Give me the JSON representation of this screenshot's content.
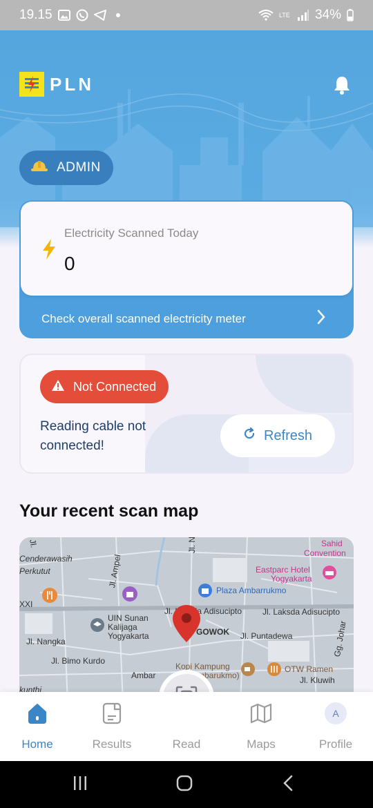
{
  "status_bar": {
    "time": "19.15",
    "battery": "34%",
    "network": "LTE",
    "icons": [
      "gallery-icon",
      "whatsapp-icon",
      "telegram-icon",
      "wifi-icon",
      "signal-icon",
      "battery-icon"
    ]
  },
  "header": {
    "logo_text": "PLN",
    "role_label": "ADMIN"
  },
  "scan_card": {
    "label": "Electricity Scanned Today",
    "count": "0",
    "footer_link": "Check overall scanned electricity meter"
  },
  "connection_card": {
    "status_badge": "Not Connected",
    "message": "Reading cable not connected!",
    "refresh_label": "Refresh",
    "status_color": "#e44d3a"
  },
  "recent_map": {
    "title": "Your recent scan map",
    "labels": {
      "sahid": "Sahid",
      "convention": "Convention",
      "cenderawasih": "Cenderawasih",
      "perkutut": "Perkutut",
      "eastparc": "Eastparc Hotel",
      "yogyakarta": "Yogyakarta",
      "plaza": "Plaza Ambarrukmo",
      "ampel": "Jl. Ampel",
      "uin1": "UIN Sunan",
      "uin2": "Kalijaga",
      "uin3": "Yogyakarta",
      "adisucipto1": "Jl. Laksda Adisucipto",
      "adisucipto2": "Jl. Laksda Adisucipto",
      "gowok": "GOWOK",
      "nangka": "Jl. Nangka",
      "puntadewa": "Jl. Puntadewa",
      "johar": "Gg. Johar",
      "bimo": "Jl. Bimo Kurdo",
      "kopi1": "Kopi Kampung",
      "kopi2": "(Ambarukmo)",
      "ambar": "Ambar",
      "otw": "OTW Ramen",
      "kluwih": "Jl. Kluwih",
      "xxi": "XXI",
      "kunthi": "kunthi",
      "jl_top": "Jl.",
      "jl_n": "Jl. N"
    }
  },
  "bottom_nav": {
    "items": [
      {
        "label": "Home",
        "icon": "home-icon",
        "active": true
      },
      {
        "label": "Results",
        "icon": "document-icon",
        "active": false
      },
      {
        "label": "Read",
        "icon": "scan-icon",
        "active": false
      },
      {
        "label": "Maps",
        "icon": "map-icon",
        "active": false
      },
      {
        "label": "Profile",
        "icon": "avatar-icon",
        "active": false
      }
    ],
    "profile_initial": "A"
  },
  "colors": {
    "brand_blue": "#4d9fdd",
    "accent": "#3b86c6",
    "warning": "#e44d3a",
    "logo_yellow": "#f4e21d"
  }
}
